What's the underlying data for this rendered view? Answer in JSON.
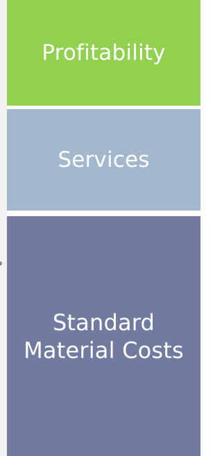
{
  "blocks": [
    {
      "label": "Profitability",
      "color": "#92d050"
    },
    {
      "label": "Services",
      "color": "#a3b8cd"
    },
    {
      "label_lines": [
        "Standard",
        "Material Costs"
      ],
      "color": "#717a9f"
    }
  ],
  "colors": {
    "background": "#ffffff",
    "text": "#ffffff",
    "side_strip": "#f1f1f1",
    "side_marker": "#8a8a8a"
  }
}
